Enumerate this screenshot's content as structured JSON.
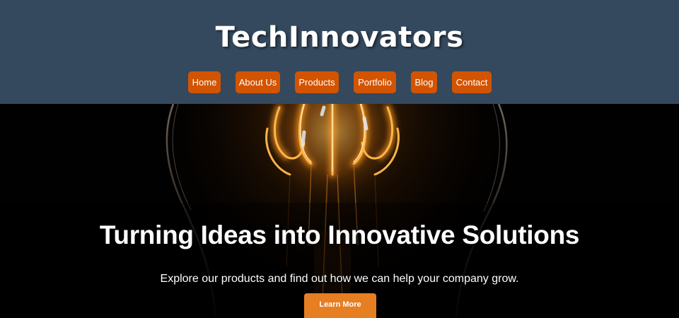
{
  "header": {
    "site_title": "TechInnovators",
    "background_color": "#34495e",
    "nav": [
      {
        "label": "Home"
      },
      {
        "label": "About Us"
      },
      {
        "label": "Products"
      },
      {
        "label": "Portfolio"
      },
      {
        "label": "Blog"
      },
      {
        "label": "Contact"
      }
    ],
    "nav_button_color": "#d35400"
  },
  "hero": {
    "background_image": "glowing-light-bulb-filament",
    "heading": "Turning Ideas into Innovative Solutions",
    "subheading": "Explore our products and find out how we can help your company grow.",
    "cta_label": "Learn More",
    "cta_color": "#e67e22"
  }
}
